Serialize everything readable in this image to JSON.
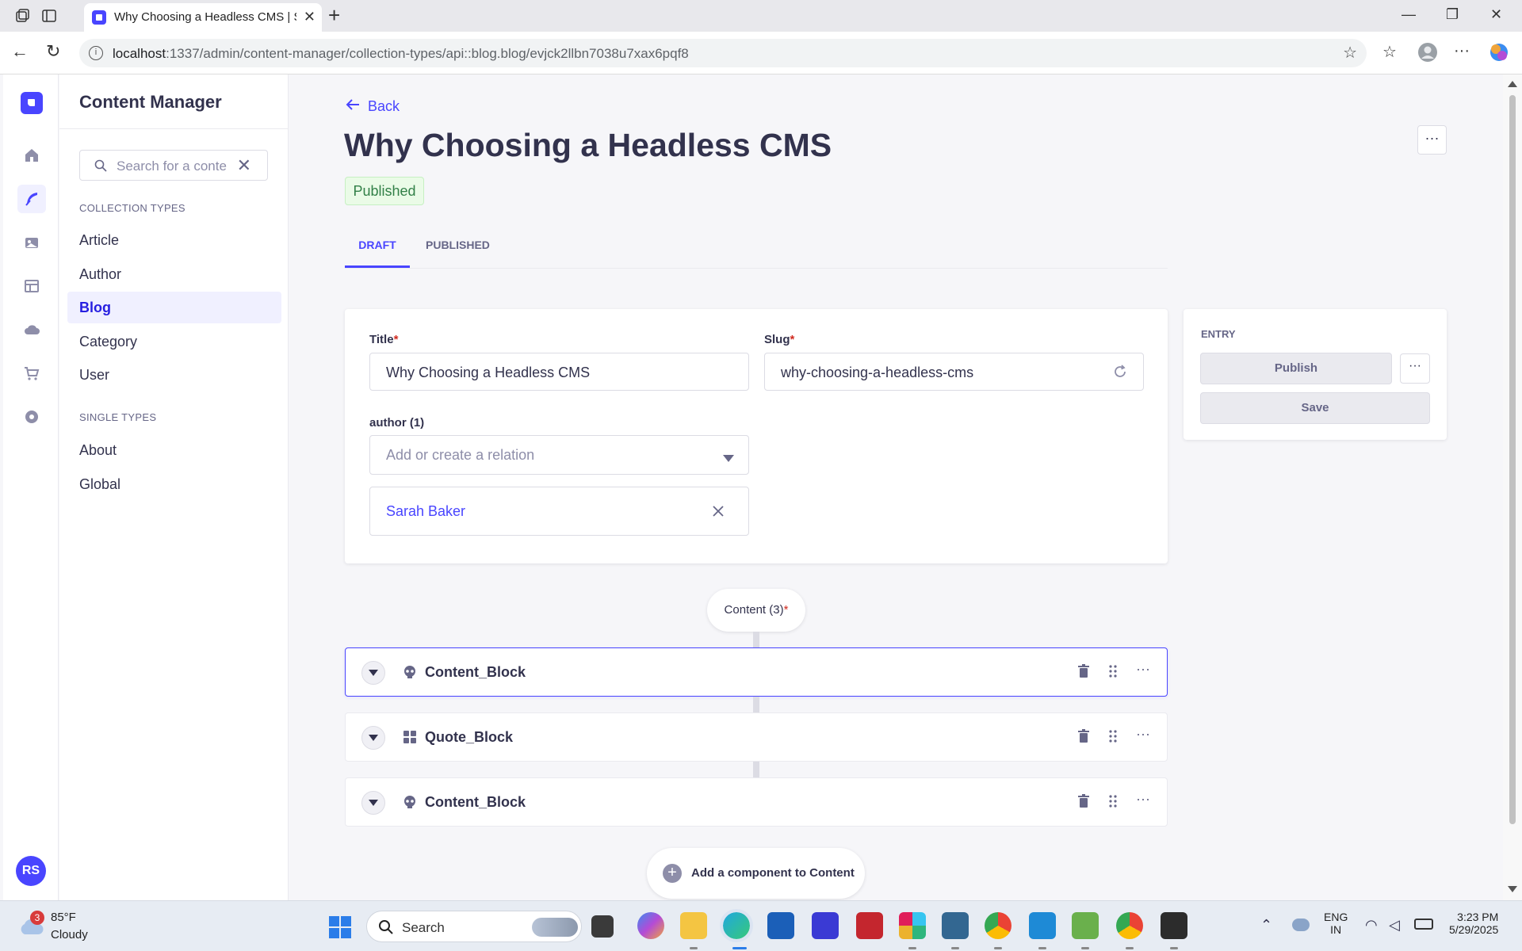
{
  "browser": {
    "tab_title": "Why Choosing a Headless CMS | S",
    "url_host": "localhost",
    "url_rest": ":1337/admin/content-manager/collection-types/api::blog.blog/evjck2llbn7038u7xax6pqf8"
  },
  "sidebar": {
    "title": "Content Manager",
    "search_placeholder": "Search for a conte",
    "collection_label": "COLLECTION TYPES",
    "collection_items": [
      "Article",
      "Author",
      "Blog",
      "Category",
      "User"
    ],
    "single_label": "SINGLE TYPES",
    "single_items": [
      "About",
      "Global"
    ],
    "avatar": "RS"
  },
  "main": {
    "back": "Back",
    "title": "Why Choosing a Headless CMS",
    "status": "Published",
    "tabs": [
      "DRAFT",
      "PUBLISHED"
    ],
    "fields": {
      "title_label": "Title",
      "title_value": "Why Choosing a Headless CMS",
      "slug_label": "Slug",
      "slug_value": "why-choosing-a-headless-cms",
      "author_label": "author (1)",
      "relation_placeholder": "Add or create a relation",
      "relation_item": "Sarah Baker"
    },
    "required_mark": "*",
    "entry": {
      "label": "ENTRY",
      "publish": "Publish",
      "save": "Save"
    },
    "dynamic_zone": {
      "label": "Content (3)",
      "components": [
        "Content_Block",
        "Quote_Block",
        "Content_Block"
      ],
      "add_label": "Add a component to Content"
    }
  },
  "taskbar": {
    "weather_temp": "85°F",
    "weather_desc": "Cloudy",
    "weather_badge": "3",
    "search": "Search",
    "lang1": "ENG",
    "lang2": "IN",
    "time": "3:23 PM",
    "date": "5/29/2025"
  },
  "colors": {
    "primary": "#4945ff",
    "success": "#328048",
    "danger": "#d02b20"
  }
}
